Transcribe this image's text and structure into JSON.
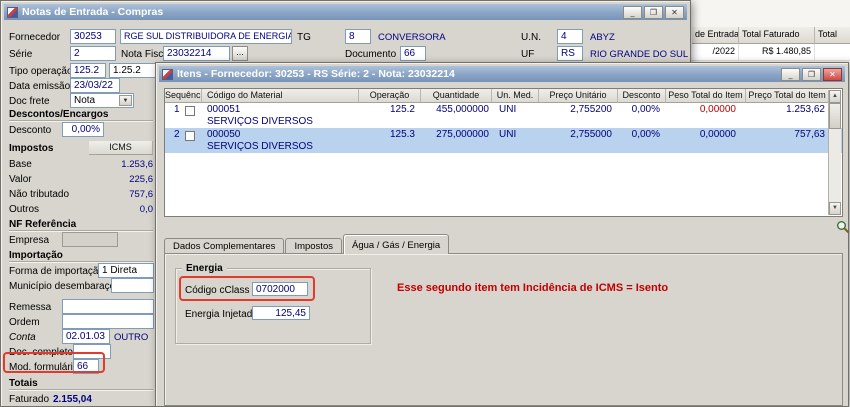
{
  "icons": {
    "minimize": "_",
    "maximize": "❐",
    "close": "✕",
    "dropdown_arrow": "▼",
    "scroll_up": "▲",
    "scroll_down": "▼"
  },
  "colors": {
    "value_text": "#000080",
    "annotation_red": "#c00000",
    "selected_row": "#b9d2ee",
    "titlebar_top": "#adc1da",
    "titlebar_bottom": "#7693b8"
  },
  "background_grid": {
    "col1": "de Entrada",
    "col2": "Total Faturado",
    "col3": "Total",
    "cell1": "/2022",
    "cell2": "R$ 1.480,85"
  },
  "main_window": {
    "title": "Notas de Entrada - Compras",
    "row1": {
      "fornecedor_label": "Fornecedor",
      "fornecedor_code": "30253",
      "fornecedor_name": "RGE SUL DISTRIBUIDORA DE ENERGIA S.A.",
      "tg_label": "TG",
      "tg_value": "8",
      "tg_desc": "CONVERSORA",
      "un_label": "U.N.",
      "un_value": "4",
      "un_desc": "ABYZ"
    },
    "row2": {
      "serie_label": "Série",
      "serie_value": "2",
      "nota_fiscal_label": "Nota Fiscal",
      "nota_fiscal_value": "23032214",
      "browse_button": "...",
      "documento_label": "Documento",
      "documento_value": "66",
      "uf_label": "UF",
      "uf_value": "RS",
      "uf_desc": "RIO GRANDE DO SUL"
    },
    "row3": {
      "tipo_operacao_label": "Tipo operação",
      "tipo_operacao_value": "125.2",
      "tipo_operacao_desc": "1.25.2"
    },
    "row4": {
      "data_emissao_label": "Data emissão",
      "data_emissao_value": "23/03/22"
    },
    "row5": {
      "doc_frete_label": "Doc frete",
      "doc_frete_value": "Nota"
    },
    "descontos": {
      "title": "Descontos/Encargos",
      "desconto_label": "Desconto",
      "desconto_value": "0,00%"
    },
    "impostos": {
      "title": "Impostos",
      "column_header": "ICMS",
      "rows": [
        {
          "label": "Base",
          "value": "1.253,6"
        },
        {
          "label": "Valor",
          "value": "225,6"
        },
        {
          "label": "Não tributado",
          "value": "757,6"
        },
        {
          "label": "Outros",
          "value": "0,0"
        }
      ]
    },
    "nf_referencia": {
      "title": "NF Referência",
      "empresa_label": "Empresa"
    },
    "importacao": {
      "title": "Importação",
      "forma_label": "Forma de importação",
      "forma_value": "1 Direta",
      "municipio_label": "Município desembaraço"
    },
    "misc": {
      "remessa_label": "Remessa",
      "ordem_label": "Ordem",
      "conta_label": "Conta",
      "conta_value": "02.01.03",
      "conta_desc": "OUTRO",
      "doc_completo_label": "Doc. completo",
      "mod_formulario_label": "Mod. formulário",
      "mod_formulario_value": "66"
    },
    "totais": {
      "title": "Totais",
      "faturado_label": "Faturado",
      "faturado_value": "2.155,04"
    }
  },
  "items_window": {
    "title": "Itens - Fornecedor: 30253 - RS Série: 2 - Nota: 23032214",
    "columns": [
      "Sequência",
      "Código do Material",
      "Operação",
      "Quantidade",
      "Un. Med.",
      "Preço Unitário",
      "Desconto",
      "Peso Total do Item",
      "Preço Total do Item"
    ],
    "rows": [
      {
        "seq": "1",
        "codigo": "000051",
        "descricao": "SERVIÇOS DIVERSOS",
        "operacao": "125.2",
        "quantidade": "455,000000",
        "un": "UNI",
        "preco_unitario": "2,755200",
        "desconto": "0,00%",
        "peso": "0,00000",
        "preco_total": "1.253,62"
      },
      {
        "seq": "2",
        "codigo": "000050",
        "descricao": "SERVIÇOS DIVERSOS",
        "operacao": "125.3",
        "quantidade": "275,000000",
        "un": "UNI",
        "preco_unitario": "2,755000",
        "desconto": "0,00%",
        "peso": "0,00000",
        "preco_total": "757,63"
      }
    ],
    "tabs": [
      "Dados Complementares",
      "Impostos",
      "Água / Gás / Energia"
    ],
    "energia": {
      "group_title": "Energia",
      "cclass_label": "Código cClass",
      "cclass_value": "0702000",
      "injetada_label": "Energia Injetada",
      "injetada_value": "125,45"
    },
    "annotation": "Esse segundo item tem Incidência de ICMS = Isento"
  }
}
